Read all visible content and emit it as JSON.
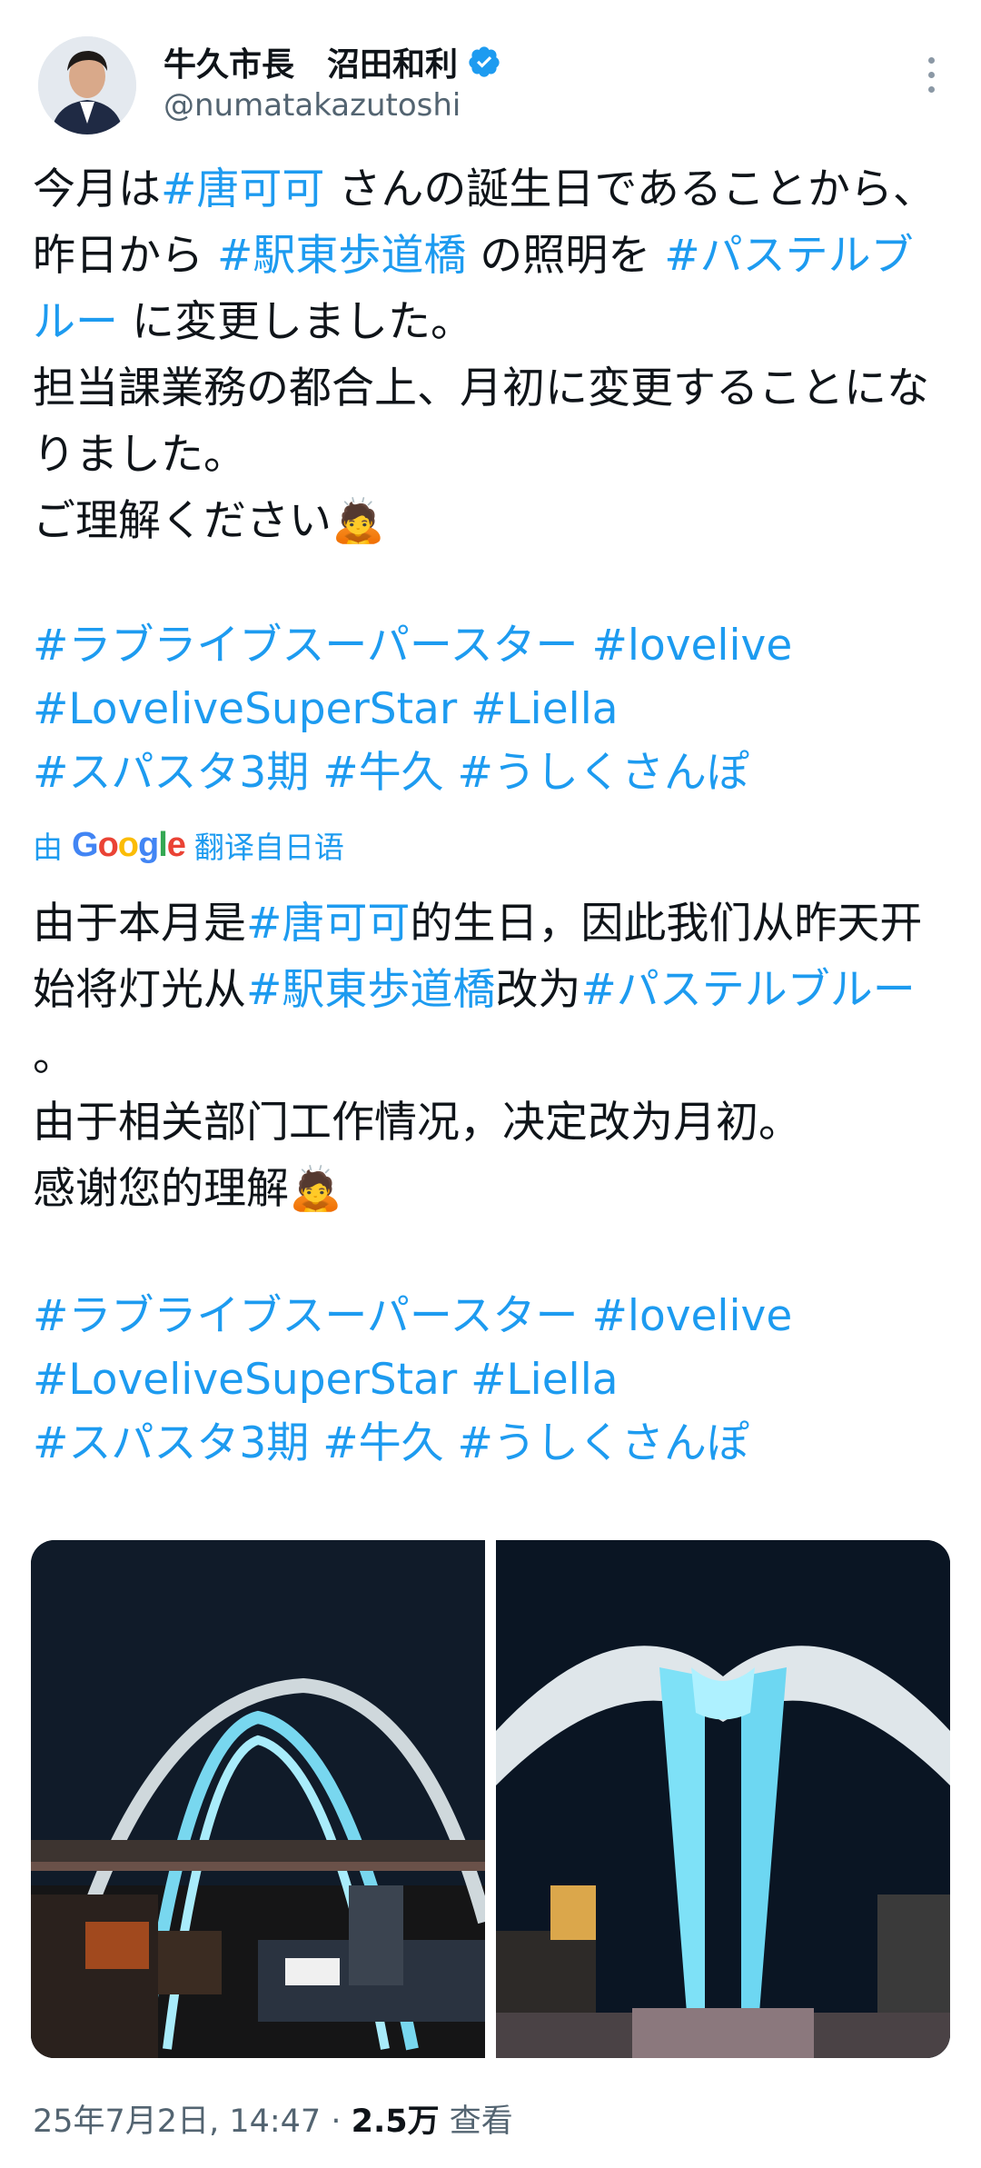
{
  "author": {
    "name": "牛久市長　沼田和利",
    "handle": "@numatakazutoshi"
  },
  "post": {
    "original_text": {
      "p1": "今月は",
      "tag1": "#唐可可",
      "p2": " さんの誕生日であることから、昨日から ",
      "tag2": "#駅東歩道橋",
      "p3": " の照明を ",
      "tag3": "#パステルブルー",
      "p4": " に変更しました。",
      "line2": "担当課業務の都合上、月初に変更することになりました。",
      "line3": "ご理解ください🙇"
    },
    "hashtags": {
      "line1": "#ラブライブスーパースター  #lovelive",
      "line2": "#LoveliveSuperStar  #Liella",
      "line3": "#スパスタ3期  #牛久 #うしくさんぽ"
    },
    "translation_label_prefix": "由",
    "translation_brand": "Google",
    "translation_label_suffix": "翻译自日语",
    "translated_text": {
      "p1": "由于本月是",
      "tag1": "#唐可可",
      "p2": "的生日，因此我们从昨天开始将灯光从",
      "tag2": "#駅東歩道橋",
      "p3": "改为",
      "tag3": "#パステルブルー",
      "p4": " 。",
      "line2": "由于相关部门工作情况，决定改为月初。",
      "line3": "感谢您的理解🙇"
    },
    "timestamp": "25年7月2日, 14:47",
    "separator": " · ",
    "views_count": "2.5万",
    "views_label": " 查看"
  },
  "colors": {
    "accent": "#1d9bf0",
    "text": "#0f1419",
    "muted": "#536471"
  },
  "icons": [
    "verified-badge-icon",
    "more-options-icon",
    "google-logo"
  ]
}
